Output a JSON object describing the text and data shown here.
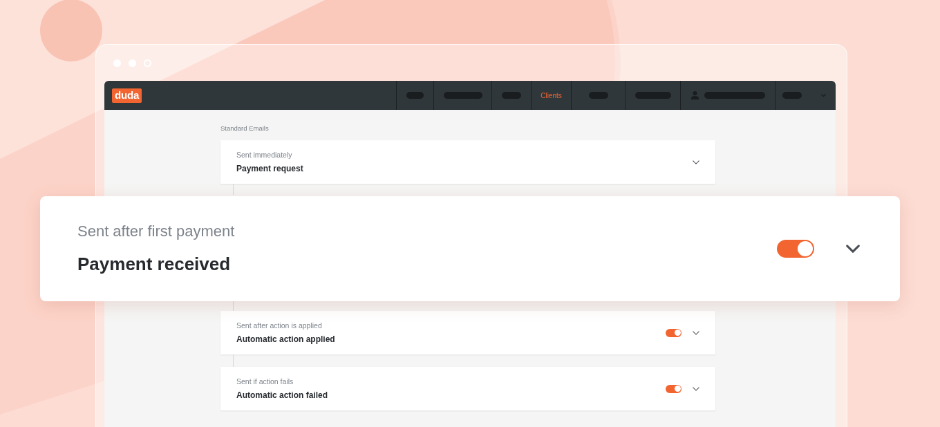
{
  "logo": "duda",
  "nav": {
    "items": [
      {
        "kind": "pill-short",
        "selected": false
      },
      {
        "kind": "pill-long",
        "selected": false
      },
      {
        "kind": "pill-short",
        "selected": false
      },
      {
        "kind": "text",
        "label": "Clients",
        "selected": true
      },
      {
        "kind": "pill-short",
        "selected": false
      },
      {
        "kind": "pill-long",
        "selected": false
      },
      {
        "kind": "user",
        "selected": false
      },
      {
        "kind": "menu",
        "selected": false
      }
    ]
  },
  "section_title": "Standard Emails",
  "emails": [
    {
      "kind": "plain",
      "trigger": "Sent immediately",
      "name": "Payment request"
    },
    {
      "kind": "hidden"
    },
    {
      "kind": "toggle",
      "trigger": "Sent after action is applied",
      "name": "Automatic action applied",
      "on": true
    },
    {
      "kind": "toggle",
      "trigger": "Sent if action fails",
      "name": "Automatic action failed",
      "on": true
    }
  ],
  "highlight": {
    "trigger": "Sent after first payment",
    "name": "Payment received",
    "on": true
  }
}
